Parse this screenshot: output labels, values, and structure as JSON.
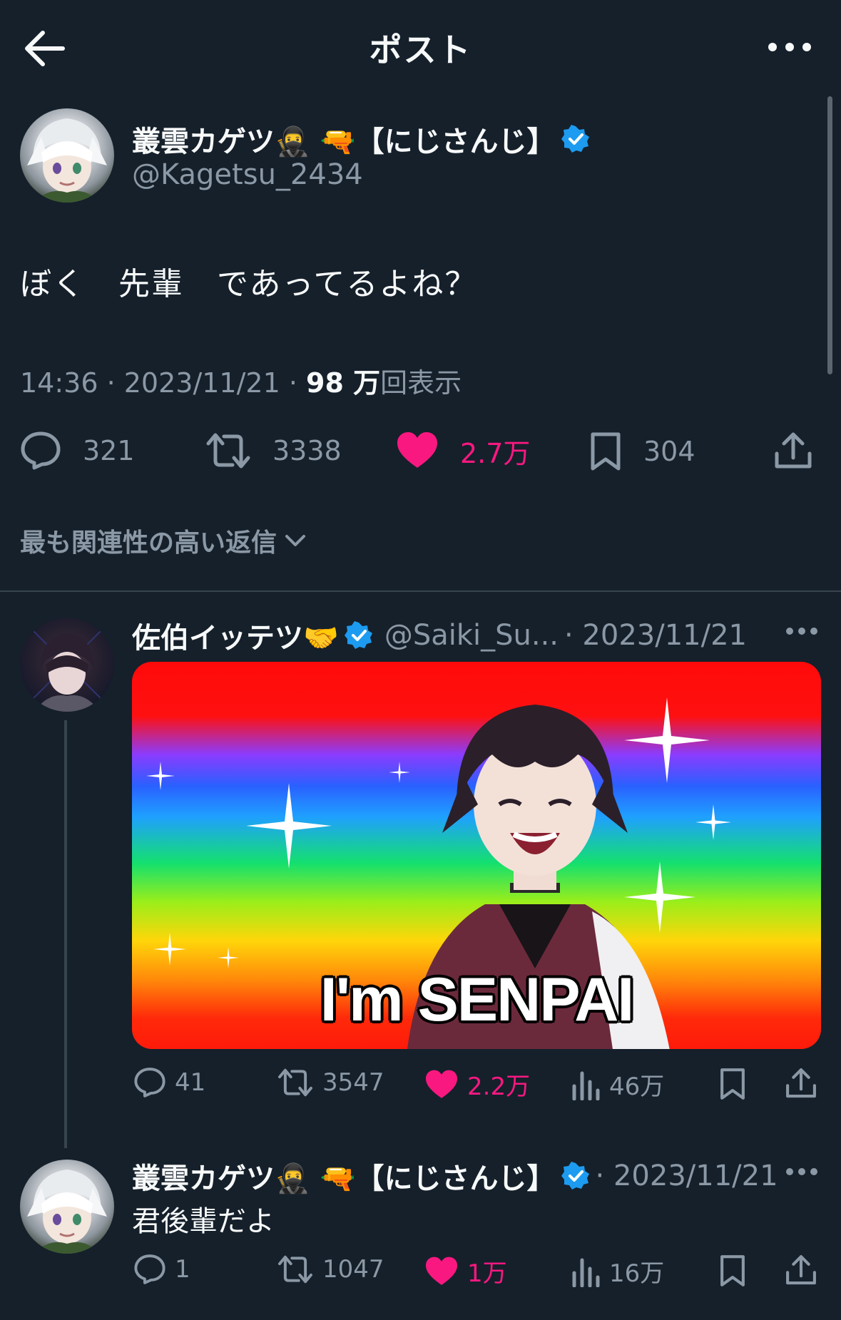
{
  "header": {
    "title": "ポスト"
  },
  "post": {
    "display_name": "叢雲カゲツ🥷 🔫【にじさんじ】",
    "handle": "@Kagetsu_2434",
    "text": "ぼく　先輩　であってるよね？",
    "time": "14:36 · 2023/11/21 · ",
    "views_count": "98 万",
    "views_label": "回表示",
    "actions": {
      "replies": "321",
      "reposts": "3338",
      "likes": "2.7万",
      "bookmarks": "304"
    }
  },
  "sort": {
    "label": "最も関連性の高い返信"
  },
  "replies": [
    {
      "display_name": "佐伯イッテツ🤝",
      "handle": "@Saiki_Su...",
      "date": "· 2023/11/21",
      "media_caption": "I'm SENPAI",
      "actions": {
        "replies": "41",
        "reposts": "3547",
        "likes": "2.2万",
        "views": "46万"
      }
    },
    {
      "display_name": "叢雲カゲツ🥷 🔫【にじさんじ】",
      "date": "· 2023/11/21",
      "text": "君後輩だよ",
      "actions": {
        "replies": "1",
        "reposts": "1047",
        "likes": "1万",
        "views": "16万"
      }
    }
  ],
  "colors": {
    "background": "#15202b",
    "text": "#f7f9f9",
    "secondary": "#8b98a5",
    "like": "#f91880",
    "verified": "#1d9bf0",
    "divider": "#38444d"
  },
  "icons": [
    "back-arrow-icon",
    "more-icon",
    "verified-badge-icon",
    "reply-icon",
    "repost-icon",
    "like-icon",
    "bookmark-icon",
    "share-icon",
    "views-icon",
    "chevron-down-icon"
  ]
}
